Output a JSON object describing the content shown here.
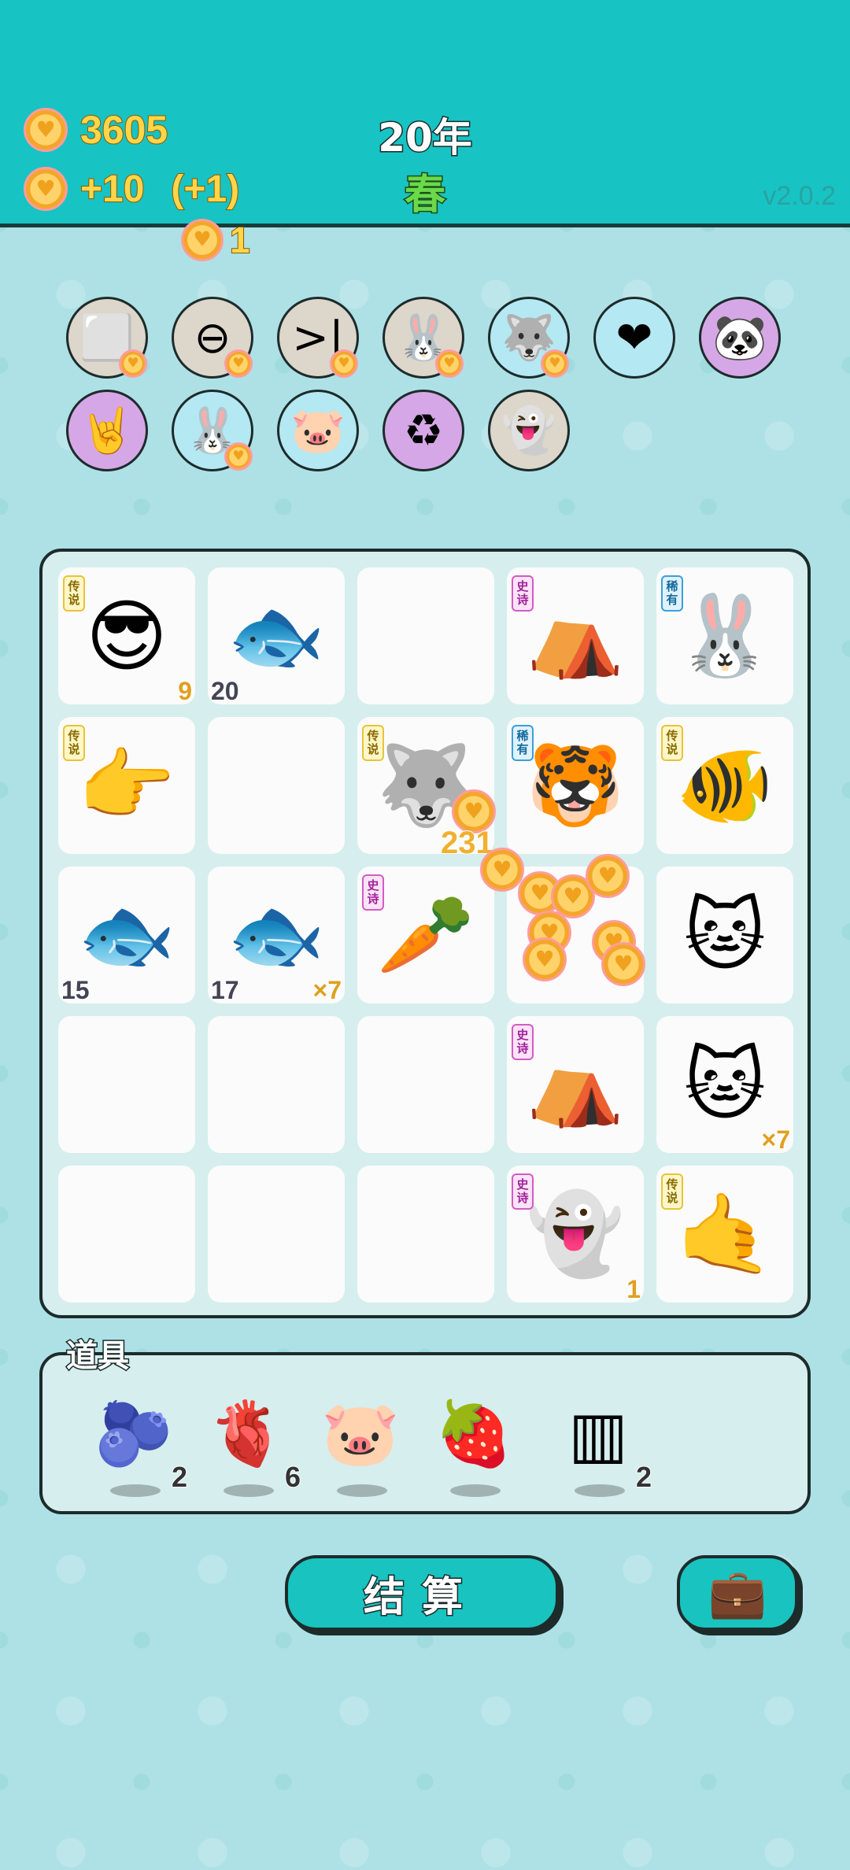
{
  "header": {
    "coins": "3605",
    "income": "+10",
    "income_bonus": "(+1)",
    "small_coin_count": "1",
    "year": "20年",
    "season": "春",
    "version": "v2.0.2"
  },
  "abilities": [
    {
      "name": "cube-stack",
      "icon": "⬜",
      "bg": "#dcd6cb",
      "coin": true
    },
    {
      "name": "minus-circle",
      "icon": "⊖",
      "bg": "#dcd6cb",
      "coin": true
    },
    {
      "name": "skip",
      "icon": ">|",
      "bg": "#dcd6cb",
      "coin": true
    },
    {
      "name": "rabbit",
      "icon": "🐰",
      "bg": "#dcd6cb",
      "coin": true
    },
    {
      "name": "husky",
      "icon": "🐺",
      "bg": "#b4e8f2",
      "coin": true
    },
    {
      "name": "heart-sign",
      "icon": "❤",
      "bg": "#b4e8f2",
      "coin": false
    },
    {
      "name": "panda",
      "icon": "🐼",
      "bg": "#d6a7e6",
      "coin": false
    },
    {
      "name": "rock-hand",
      "icon": "🤘",
      "bg": "#d6a7e6",
      "coin": false
    },
    {
      "name": "rabbit-2",
      "icon": "🐰",
      "bg": "#b4e8f2",
      "coin": true
    },
    {
      "name": "piggy-bank",
      "icon": "🐷",
      "bg": "#b4e8f2",
      "coin": false
    },
    {
      "name": "recycle",
      "icon": "♻",
      "bg": "#d6a7e6",
      "coin": false
    },
    {
      "name": "ghost",
      "icon": "👻",
      "bg": "#dcd6cb",
      "coin": false
    }
  ],
  "board": [
    {
      "icon": "😎",
      "tag": "传说",
      "tag_type": "legend",
      "num_br": "9"
    },
    {
      "icon": "🐟",
      "num_bl": "20"
    },
    {
      "icon": ""
    },
    {
      "icon": "⛺",
      "tag": "史诗",
      "tag_type": "epic"
    },
    {
      "icon": "🐰",
      "tag": "稀有",
      "tag_type": "rare"
    },
    {
      "icon": "👉",
      "tag": "传说",
      "tag_type": "legend"
    },
    {
      "icon": ""
    },
    {
      "icon": "🐺",
      "tag": "传说",
      "tag_type": "legend"
    },
    {
      "icon": "🐯",
      "tag": "稀有",
      "tag_type": "rare"
    },
    {
      "icon": "🐠",
      "tag": "传说",
      "tag_type": "legend"
    },
    {
      "icon": "🐟",
      "num_bl": "15"
    },
    {
      "icon": "🐟",
      "num_bl": "17",
      "num_br": "×7"
    },
    {
      "icon": "🥕",
      "tag": "史诗",
      "tag_type": "epic"
    },
    {
      "icon": ""
    },
    {
      "icon": "🐱"
    },
    {
      "icon": ""
    },
    {
      "icon": ""
    },
    {
      "icon": ""
    },
    {
      "icon": "⛺",
      "tag": "史诗",
      "tag_type": "epic"
    },
    {
      "icon": "🐱",
      "num_br": "×7"
    },
    {
      "icon": ""
    },
    {
      "icon": ""
    },
    {
      "icon": ""
    },
    {
      "icon": "👻",
      "tag": "史诗",
      "tag_type": "epic",
      "num_br": "1"
    },
    {
      "icon": "🤙",
      "tag": "传说",
      "tag_type": "legend"
    }
  ],
  "floating_income": "231",
  "props": {
    "title": "道具",
    "items": [
      {
        "name": "blueberry",
        "icon": "🫐",
        "count": "2"
      },
      {
        "name": "liver",
        "icon": "🫀",
        "count": "6"
      },
      {
        "name": "piggy-bank",
        "icon": "🐷",
        "count": ""
      },
      {
        "name": "bayberry",
        "icon": "🍓",
        "count": ""
      },
      {
        "name": "jars",
        "icon": "▥",
        "count": "2"
      }
    ]
  },
  "buttons": {
    "settle": "结算",
    "bag_icon": "💼"
  }
}
